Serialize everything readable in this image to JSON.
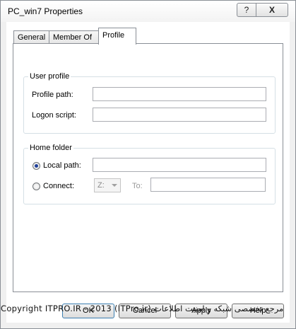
{
  "window": {
    "title": "PC_win7 Properties",
    "help_label": "?",
    "close_label": "X"
  },
  "tabs": [
    {
      "label": "General",
      "selected": false
    },
    {
      "label": "Member Of",
      "selected": false
    },
    {
      "label": "Profile",
      "selected": true
    }
  ],
  "user_profile": {
    "legend": "User profile",
    "profile_path_label": "Profile path:",
    "profile_path_value": "",
    "logon_script_label": "Logon script:",
    "logon_script_value": ""
  },
  "home_folder": {
    "legend": "Home folder",
    "local_path_label": "Local path:",
    "local_path_selected": true,
    "local_path_value": "",
    "connect_label": "Connect:",
    "connect_selected": false,
    "drive_value": "Z:",
    "to_label": "To:",
    "to_value": ""
  },
  "buttons": {
    "ok": "OK",
    "cancel": "Cancel",
    "apply": "Apply",
    "help": "Help"
  },
  "watermark": "Copyright ITPRO.IR - 2013 (ITPro.ir) مرجع تخصصی شبکه و امنیت اطلاعات"
}
